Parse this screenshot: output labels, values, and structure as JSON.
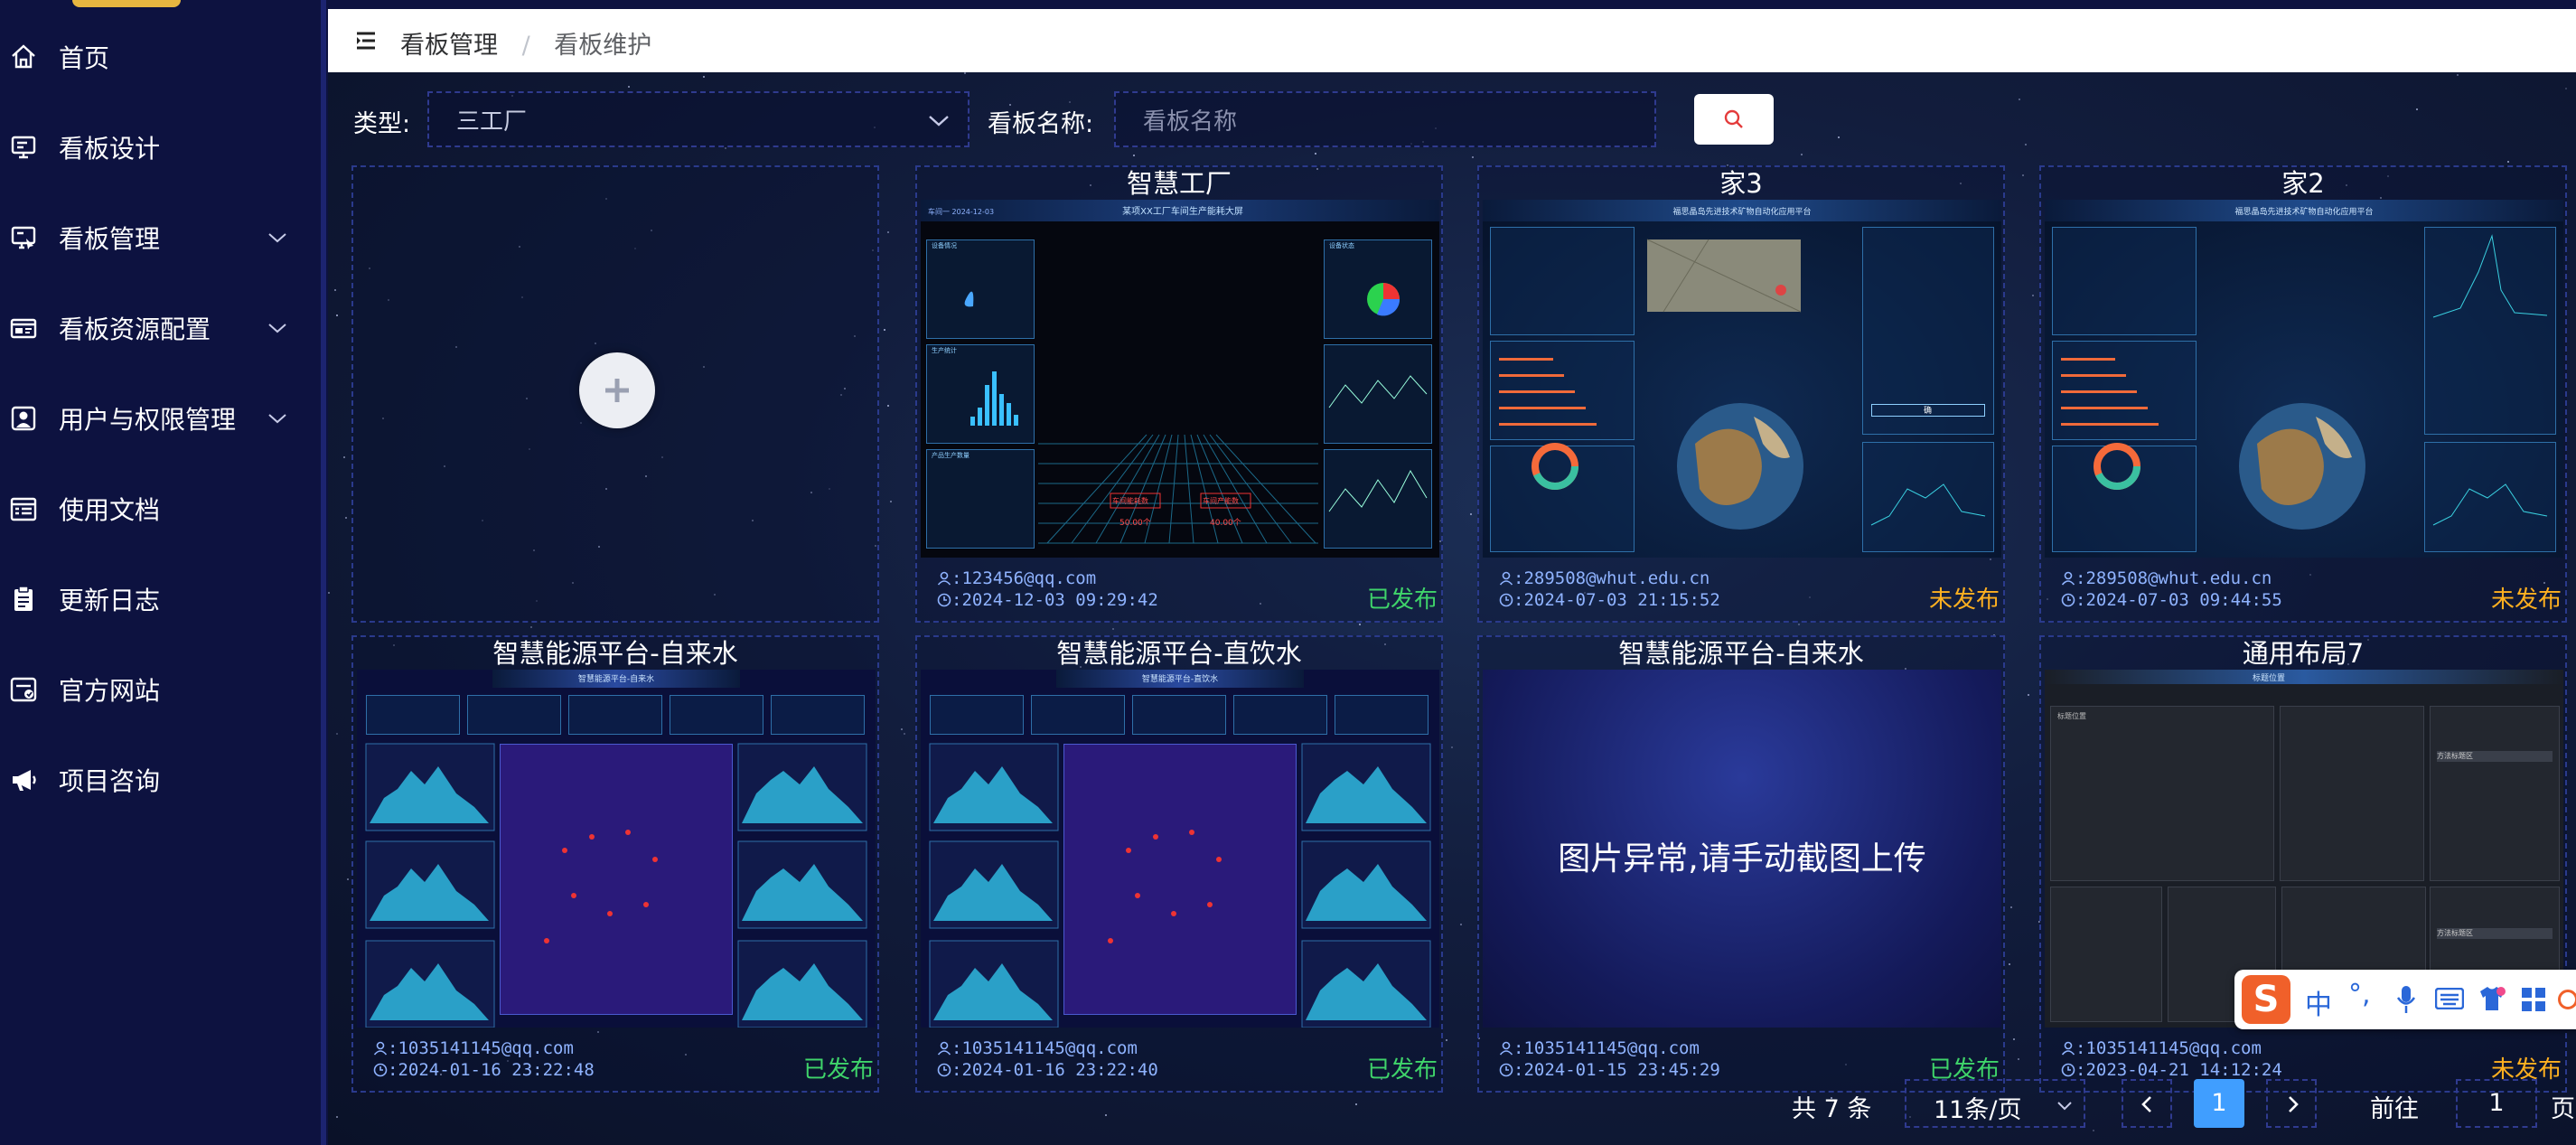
{
  "sidebar": {
    "items": [
      {
        "label": "首页",
        "icon": "home-icon"
      },
      {
        "label": "看板设计",
        "icon": "monitor-icon"
      },
      {
        "label": "看板管理",
        "icon": "board-manage-icon",
        "expand": true
      },
      {
        "label": "看板资源配置",
        "icon": "resource-icon",
        "expand": true
      },
      {
        "label": "用户与权限管理",
        "icon": "user-icon",
        "expand": true
      },
      {
        "label": "使用文档",
        "icon": "doc-icon"
      },
      {
        "label": "更新日志",
        "icon": "clipboard-icon"
      },
      {
        "label": "官方网站",
        "icon": "website-icon"
      },
      {
        "label": "项目咨询",
        "icon": "megaphone-icon"
      }
    ]
  },
  "header": {
    "breadcrumb": [
      "看板管理",
      "看板维护"
    ],
    "separator": "/"
  },
  "filter": {
    "type_label": "类型:",
    "type_value": "三工厂",
    "name_label": "看板名称:",
    "name_placeholder": "看板名称"
  },
  "cards": [
    {
      "title": "智慧工厂",
      "email": ":123456@qq.com",
      "time": ":2024-12-03 09:29:42",
      "status": "已发布",
      "published": true,
      "thumb": "factory",
      "thumb_text": {
        "header": "某项XX工厂车间生产能耗大屏",
        "top_left": "车间一 2024-12-03",
        "panel1": "设备情况",
        "panel2": "生产统计",
        "panel3": "产品生产数量",
        "panel4": "设备状态",
        "alarm1": "车间能耗数",
        "alarm2": "车间产能数",
        "val1": "50.00个",
        "val2": "40.00个"
      }
    },
    {
      "title": "家3",
      "email": ":289508@whut.edu.cn",
      "time": ":2024-07-03 21:15:52",
      "status": "未发布",
      "published": false,
      "thumb": "earth",
      "thumb_text": {
        "header": "福思晶岛先进技术矿物自动化应用平台",
        "btn": "确"
      }
    },
    {
      "title": "家2",
      "email": ":289508@whut.edu.cn",
      "time": ":2024-07-03 09:44:55",
      "status": "未发布",
      "published": false,
      "thumb": "earth2",
      "thumb_text": {
        "header": "福思晶岛先进技术矿物自动化应用平台"
      }
    },
    {
      "title": "智慧能源平台-自来水",
      "email": ":1035141145@qq.com",
      "time": ":2024-01-16 23:22:48",
      "status": "已发布",
      "published": true,
      "thumb": "energy",
      "thumb_text": {
        "header": "智慧能源平台-自来水"
      }
    },
    {
      "title": "智慧能源平台-直饮水",
      "email": ":1035141145@qq.com",
      "time": ":2024-01-16 23:22:40",
      "status": "已发布",
      "published": true,
      "thumb": "energy",
      "thumb_text": {
        "header": "智慧能源平台-直饮水"
      }
    },
    {
      "title": "智慧能源平台-自来水",
      "email": ":1035141145@qq.com",
      "time": ":2024-01-15 23:45:29",
      "status": "已发布",
      "published": true,
      "thumb": "error",
      "thumb_text": {
        "message": "图片异常,请手动截图上传"
      }
    },
    {
      "title": "通用布局7",
      "email": ":1035141145@qq.com",
      "time": ":2023-04-21 14:12:24",
      "status": "未发布",
      "published": false,
      "thumb": "layout",
      "thumb_text": {
        "header": "标题位置",
        "cell": "标题位置",
        "list1": "方法标题区",
        "list2": "方法标题区"
      }
    }
  ],
  "pagination": {
    "total": "共 7 条",
    "page_size": "11条/页",
    "current": "1",
    "goto_label": "前往",
    "goto_value": "1",
    "page_suffix": "页"
  },
  "ime": {
    "logo": "S",
    "lang": "中",
    "punct": "°,"
  },
  "colors": {
    "published": "#3fd46a",
    "unpublished": "#ffb020",
    "active_page": "#409eff",
    "sidebar_bg": "#0d1240"
  }
}
